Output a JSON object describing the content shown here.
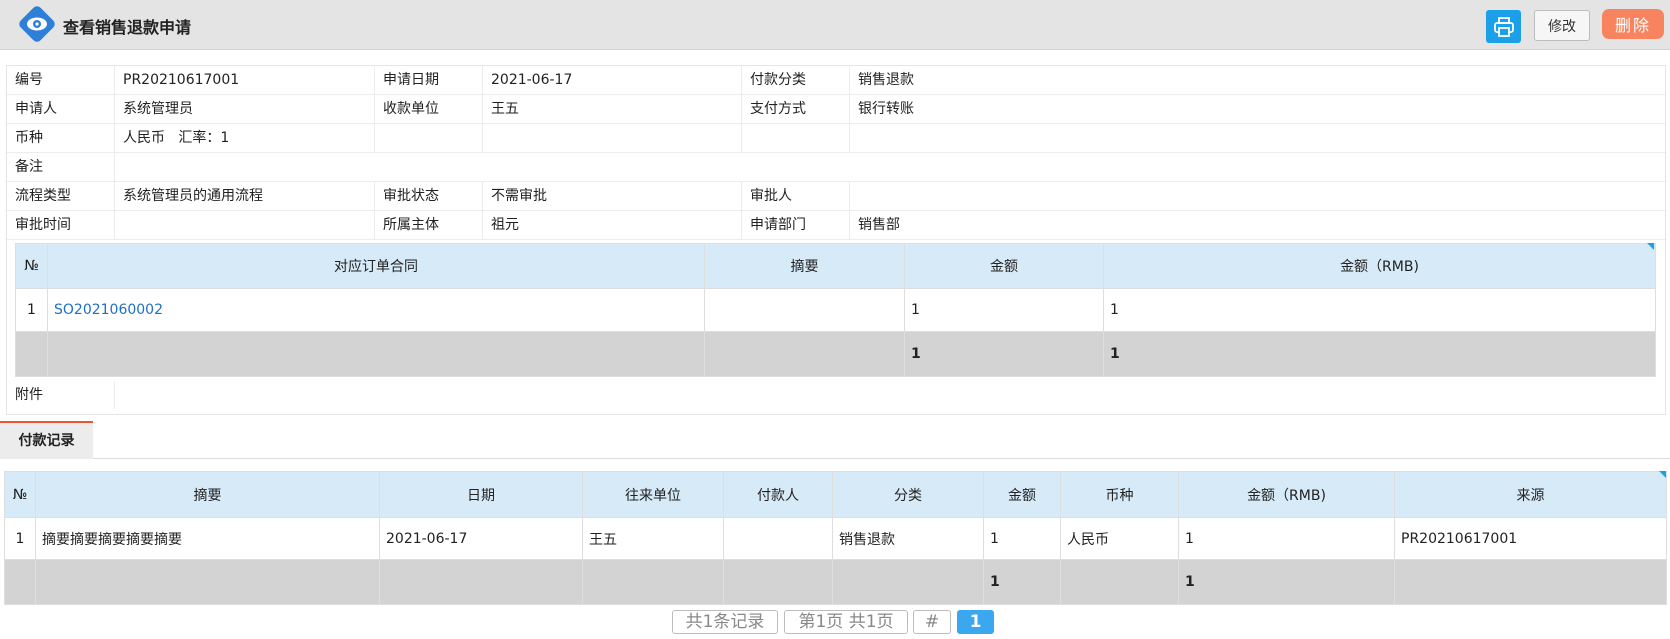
{
  "header": {
    "title": "查看销售退款申请",
    "print_icon": "printer-icon",
    "edit_label": "修改",
    "delete_label": "删除"
  },
  "info": {
    "rows": [
      [
        "编号",
        "PR20210617001",
        "申请日期",
        "2021-06-17",
        "付款分类",
        "销售退款"
      ],
      [
        "申请人",
        "系统管理员",
        "收款单位",
        "王五",
        "支付方式",
        "银行转账"
      ],
      [
        "币种",
        "人民币   汇率：1",
        "",
        "",
        "",
        ""
      ],
      [
        "流程类型",
        "系统管理员的通用流程",
        "审批状态",
        "不需审批",
        "审批人",
        ""
      ],
      [
        "审批时间",
        "",
        "所属主体",
        "祖元",
        "申请部门",
        "销售部"
      ]
    ],
    "remark_label": "备注",
    "remark_value": "",
    "attach_label": "附件"
  },
  "order_table": {
    "headers": [
      "№",
      "对应订单合同",
      "摘要",
      "金额",
      "金额（RMB)"
    ],
    "rows": [
      [
        "1",
        "SO2021060002",
        "",
        "1",
        "1"
      ]
    ],
    "totals": [
      "",
      "",
      "",
      "1",
      "1"
    ]
  },
  "tabs": {
    "payment_records": "付款记录"
  },
  "payment_table": {
    "headers": [
      "№",
      "摘要",
      "日期",
      "往来单位",
      "付款人",
      "分类",
      "金额",
      "币种",
      "金额（RMB)",
      "来源"
    ],
    "rows": [
      [
        "1",
        "摘要摘要摘要摘要摘要",
        "2021-06-17",
        "王五",
        "",
        "销售退款",
        "1",
        "人民币",
        "1",
        "PR20210617001"
      ]
    ],
    "totals": [
      "",
      "",
      "",
      "",
      "",
      "",
      "1",
      "",
      "1",
      ""
    ]
  },
  "pager": {
    "records": "共1条记录",
    "pages": "第1页 共1页",
    "hash": "#",
    "current": "1"
  },
  "colors": {
    "accent": "#1a9fe8",
    "danger": "#f7845f",
    "header_bg": "#d6eaf8"
  }
}
